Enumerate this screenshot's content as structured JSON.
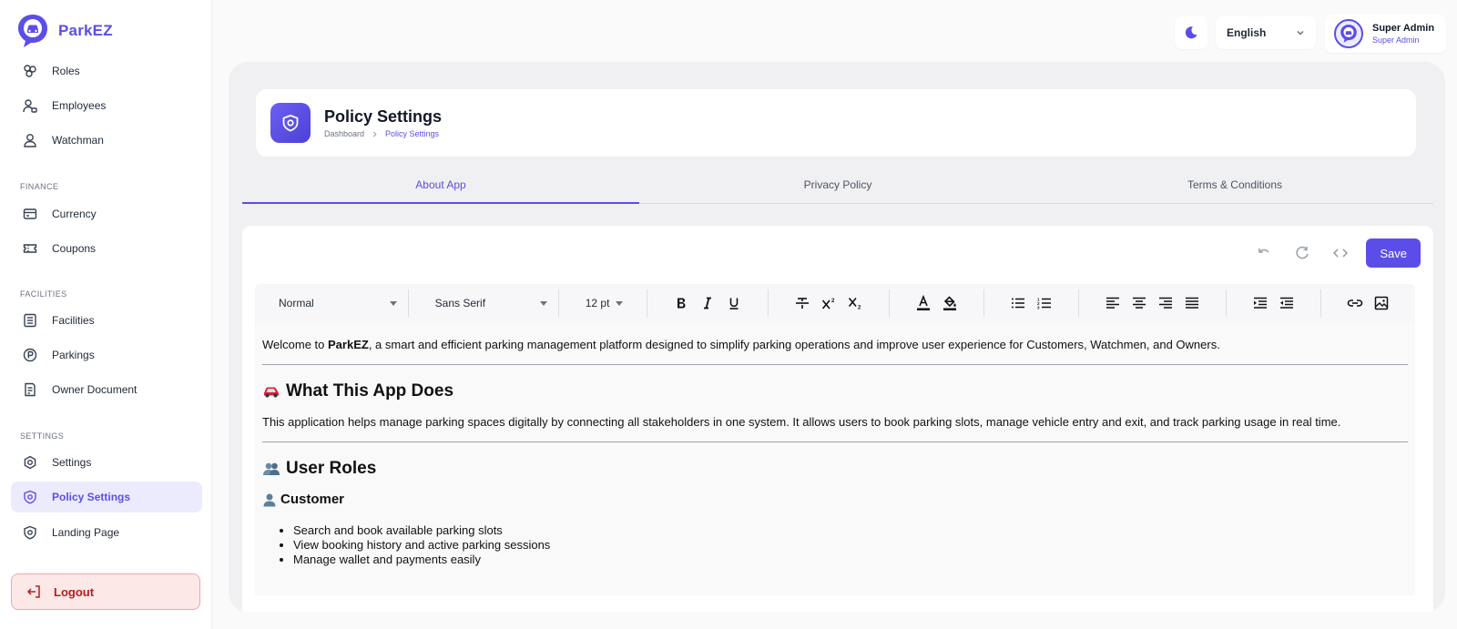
{
  "brand": {
    "name": "ParkEZ"
  },
  "sidebar": {
    "items_top": [
      {
        "label": "Roles",
        "icon": "roles-icon"
      },
      {
        "label": "Employees",
        "icon": "employees-icon"
      },
      {
        "label": "Watchman",
        "icon": "user-icon"
      }
    ],
    "finance": {
      "label": "FINANCE",
      "items": [
        {
          "label": "Currency",
          "icon": "wallet-icon"
        },
        {
          "label": "Coupons",
          "icon": "ticket-icon"
        }
      ]
    },
    "facilities": {
      "label": "FACILITIES",
      "items": [
        {
          "label": "Facilities",
          "icon": "building-icon"
        },
        {
          "label": "Parkings",
          "icon": "parking-icon"
        },
        {
          "label": "Owner Document",
          "icon": "document-icon"
        }
      ]
    },
    "settings": {
      "label": "SETTINGS",
      "items": [
        {
          "label": "Settings",
          "icon": "gear-icon"
        },
        {
          "label": "Policy Settings",
          "icon": "shield-icon",
          "active": true
        },
        {
          "label": "Landing Page",
          "icon": "shield-icon"
        }
      ]
    },
    "logout": "Logout"
  },
  "topbar": {
    "language": "English",
    "user_name": "Super Admin",
    "user_role": "Super Admin"
  },
  "header": {
    "title": "Policy Settings",
    "breadcrumb": [
      "Dashboard",
      "Policy Settings"
    ]
  },
  "tabs": [
    {
      "label": "About App",
      "active": true
    },
    {
      "label": "Privacy Policy"
    },
    {
      "label": "Terms & Conditions"
    }
  ],
  "editor": {
    "save_label": "Save",
    "toolbar": {
      "format": "Normal",
      "font": "Sans Serif",
      "size": "12 pt"
    },
    "content": {
      "intro_prefix": "Welcome to ",
      "intro_brand": "ParkEZ",
      "intro_suffix": ", a smart and efficient parking management platform designed to simplify parking operations and improve user experience for Customers, Watchmen, and Owners.",
      "heading_1": "What This App Does",
      "paragraph_1": "This application helps manage parking spaces digitally by connecting all stakeholders in one system. It allows users to book parking slots, manage vehicle entry and exit, and track parking usage in real time.",
      "heading_2": "User Roles",
      "subheading_1": "Customer",
      "customer_items": [
        "Search and book available parking slots",
        "View booking history and active parking sessions",
        "Manage wallet and payments easily"
      ]
    }
  },
  "colors": {
    "accent": "#5b4ee8",
    "logout_bg": "#fde8e8",
    "logout_text": "#b91c1c"
  }
}
